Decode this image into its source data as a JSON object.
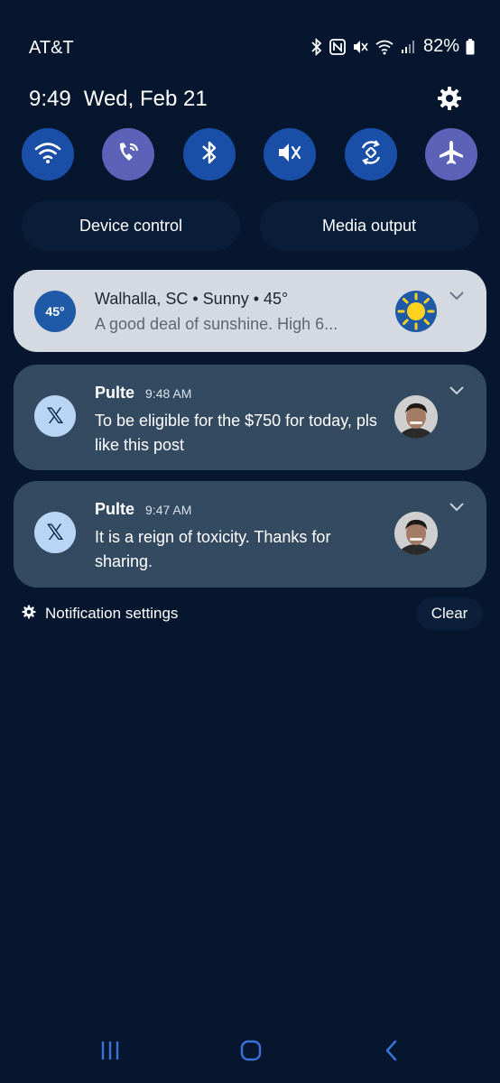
{
  "status_bar": {
    "carrier": "AT&T",
    "battery_percent": "82%",
    "icons": [
      "bluetooth-icon",
      "nfc-icon",
      "mute-icon",
      "wifi-calling-icon",
      "signal-icon",
      "battery-icon"
    ]
  },
  "header": {
    "time": "9:49",
    "date": "Wed, Feb 21"
  },
  "quick_settings": {
    "tiles": [
      {
        "name": "wifi",
        "icon": "wifi-icon",
        "active": true
      },
      {
        "name": "wifi-calling",
        "icon": "wifi-calling-icon",
        "active": true
      },
      {
        "name": "bluetooth",
        "icon": "bluetooth-icon",
        "active": true
      },
      {
        "name": "sound",
        "icon": "mute-icon",
        "active": true
      },
      {
        "name": "auto-rotate",
        "icon": "rotate-icon",
        "active": true
      },
      {
        "name": "airplane",
        "icon": "airplane-icon",
        "active": true
      }
    ],
    "device_control_label": "Device control",
    "media_output_label": "Media output"
  },
  "notifications": [
    {
      "type": "weather",
      "badge": "45°",
      "title": "Walhalla, SC • Sunny • 45°",
      "text": "A good deal of sunshine. High 6..."
    },
    {
      "type": "x",
      "badge_icon": "x-logo-icon",
      "badge": "𝕏",
      "sender": "Pulte",
      "time": "9:48 AM",
      "text": "To be eligible for the $750 for today, pls like this post"
    },
    {
      "type": "x",
      "badge_icon": "x-logo-icon",
      "badge": "𝕏",
      "sender": "Pulte",
      "time": "9:47 AM",
      "text": "It is a reign of toxicity. Thanks for sharing."
    }
  ],
  "footer": {
    "notification_settings_label": "Notification settings",
    "clear_label": "Clear"
  },
  "colors": {
    "background": "#06162f",
    "tile_blue": "#1a4fa8",
    "tile_violet": "#5b62b8",
    "weather_card": "#d5d9e1",
    "note_card": "#344a60"
  }
}
